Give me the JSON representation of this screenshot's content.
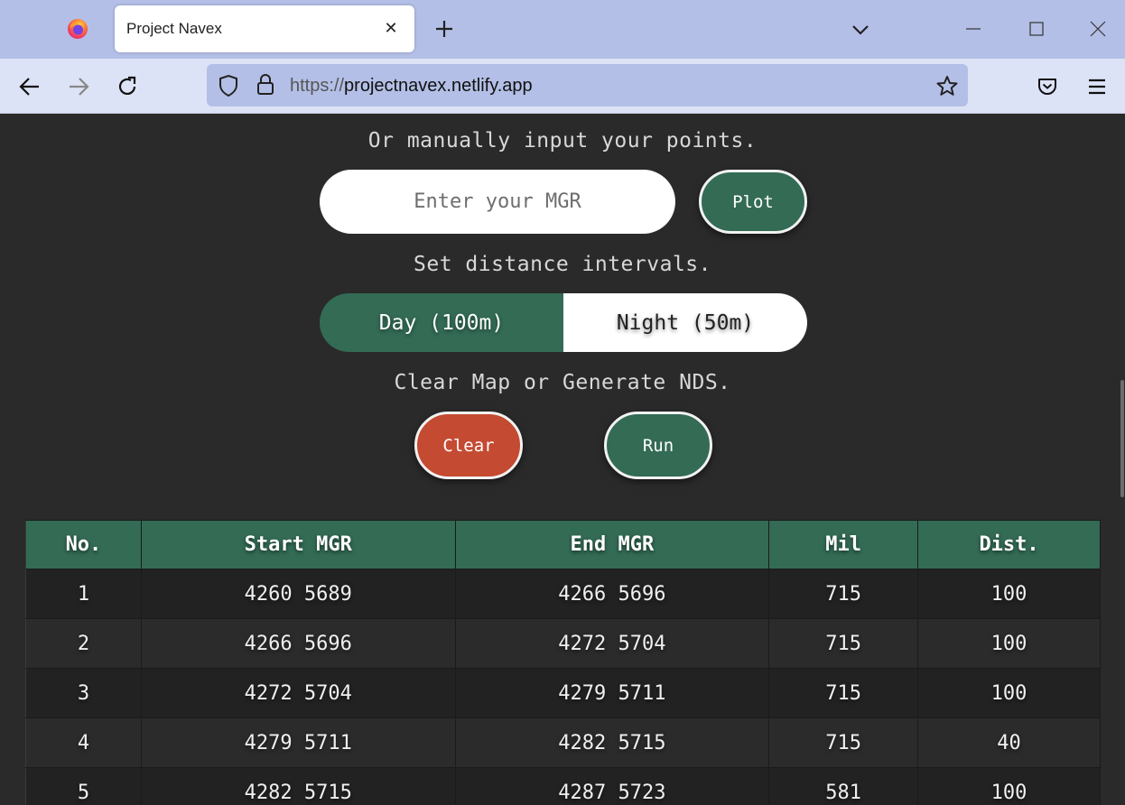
{
  "browser": {
    "tab_title": "Project Navex",
    "url_protocol": "https://",
    "url_host": "projectnavex.netlify.app",
    "icons": [
      "firefox-logo",
      "close-icon",
      "plus-icon",
      "chevron-down-icon",
      "minimize-icon",
      "maximize-icon",
      "window-close-icon",
      "back-arrow-icon",
      "forward-arrow-icon",
      "reload-icon",
      "shield-icon",
      "lock-icon",
      "star-icon",
      "pocket-icon",
      "hamburger-menu-icon"
    ]
  },
  "page": {
    "manual_prompt": "Or manually input your points.",
    "mgr_input": {
      "value": "",
      "placeholder": "Enter your MGR"
    },
    "plot_label": "Plot",
    "interval_prompt": "Set distance intervals.",
    "interval_options": {
      "day": "Day (100m)",
      "night": "Night (50m)",
      "selected": "day"
    },
    "action_prompt": "Clear Map or Generate NDS.",
    "clear_label": "Clear",
    "run_label": "Run"
  },
  "table": {
    "headers": [
      "No.",
      "Start MGR",
      "End MGR",
      "Mil",
      "Dist."
    ],
    "rows": [
      [
        "1",
        "4260 5689",
        "4266 5696",
        "715",
        "100"
      ],
      [
        "2",
        "4266 5696",
        "4272 5704",
        "715",
        "100"
      ],
      [
        "3",
        "4272 5704",
        "4279 5711",
        "715",
        "100"
      ],
      [
        "4",
        "4279 5711",
        "4282 5715",
        "715",
        "40"
      ],
      [
        "5",
        "4282 5715",
        "4287 5723",
        "581",
        "100"
      ]
    ]
  },
  "colors": {
    "page_bg": "#2a2a2a",
    "accent_green": "#336b55",
    "clear_red": "#c44a32",
    "tabbar_bg": "#b3bfe6",
    "navbar_bg": "#dde3f6"
  }
}
